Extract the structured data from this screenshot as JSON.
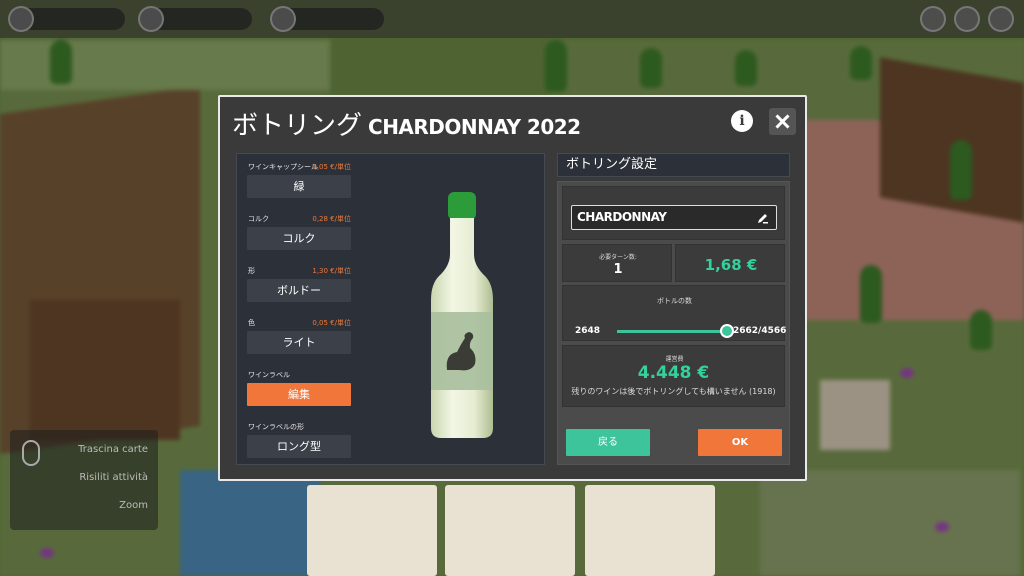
{
  "dialog": {
    "title": "ボトリング",
    "wine_name": "CHARDONNAY 2022",
    "info_icon": "info-icon",
    "close_icon": "close-icon"
  },
  "options": [
    {
      "label": "ワインキャップシール",
      "price": "0,05 €/単位",
      "value": "緑"
    },
    {
      "label": "コルク",
      "price": "0,28 €/単位",
      "value": "コルク"
    },
    {
      "label": "形",
      "price": "1,30 €/単位",
      "value": "ボルドー"
    },
    {
      "label": "色",
      "price": "0,05 €/単位",
      "value": "ライト"
    },
    {
      "label": "ワインラベル",
      "price": "",
      "value": "編集"
    },
    {
      "label": "ワインラベルの形",
      "price": "",
      "value": "ロング型"
    }
  ],
  "settings": {
    "header": "ボトリング設定",
    "name_value": "CHARDONNAY",
    "turns_label": "必要ターン数:",
    "turns_value": "1",
    "cost_value": "1,68 €",
    "bottles_label": "ボトルの数",
    "bottles_min": "2648",
    "bottles_max": "2662/4566",
    "bottles_fraction": 0.95,
    "ops_label": "運営費",
    "ops_value": "4.448 €",
    "ops_note": "残りのワインは後でボトリングしても構いません (1918)",
    "back_label": "戻る",
    "ok_label": "OK"
  },
  "hint": {
    "lines": [
      "Trascina carte",
      "Risiliti attività",
      "Zoom"
    ]
  },
  "colors": {
    "accent_orange": "#f0763a",
    "accent_green": "#3ec49a",
    "value_green": "#34d19a",
    "bottle_cap": "#2c9c3a"
  }
}
